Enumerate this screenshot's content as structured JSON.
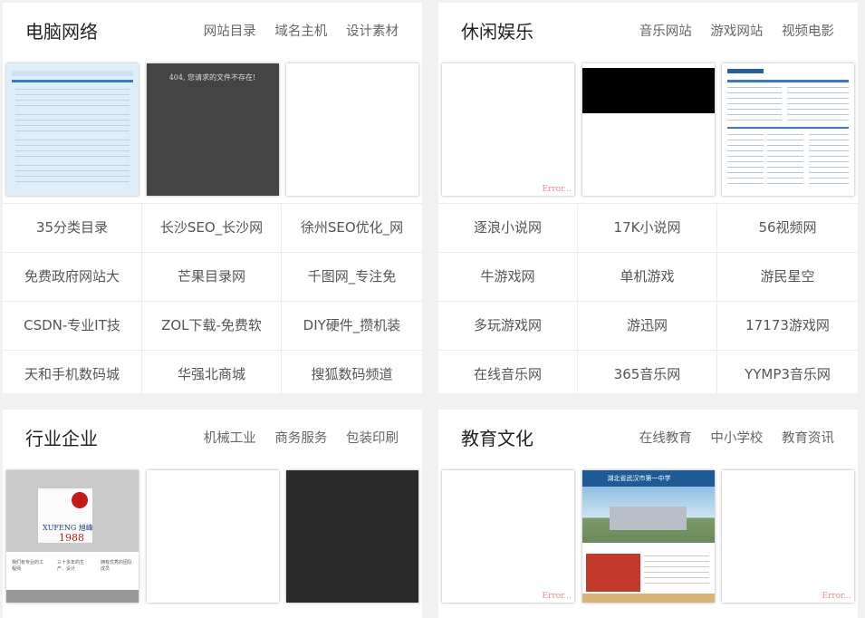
{
  "panels": [
    {
      "title": "电脑网络",
      "links": [
        "网站目录",
        "域名主机",
        "设计素材"
      ],
      "thumb_text": {
        "t1": "404, 您请求的文件不存在!"
      },
      "items": [
        "35分类目录",
        "长沙SEO_长沙网",
        "徐州SEO优化_网",
        "免费政府网站大",
        "芒果目录网",
        "千图网_专注免",
        "CSDN-专业IT技",
        "ZOL下载-免费软",
        "DIY硬件_攒机装",
        "天和手机数码城",
        "华强北商城",
        "搜狐数码频道"
      ]
    },
    {
      "title": "休闲娱乐",
      "links": [
        "音乐网站",
        "游戏网站",
        "视频电影"
      ],
      "thumb_text": {
        "t0": "Error..."
      },
      "items": [
        "逐浪小说网",
        "17K小说网",
        "56视频网",
        "牛游戏网",
        "单机游戏",
        "游民星空",
        "多玩游戏网",
        "游迅网",
        "17173游戏网",
        "在线音乐网",
        "365音乐网",
        "YYMP3音乐网"
      ]
    },
    {
      "title": "行业企业",
      "links": [
        "机械工业",
        "商务服务",
        "包装印刷"
      ],
      "thumb_text": {
        "brand": "XUFENG 旭峰",
        "year": "1988",
        "c1": "我们有专业的工程师",
        "c2": "三十多年的生产、设计",
        "c3": "拥有优秀的团队成员"
      }
    },
    {
      "title": "教育文化",
      "links": [
        "在线教育",
        "中小学校",
        "教育资讯"
      ],
      "thumb_text": {
        "t0": "Error...",
        "t2": "Error...",
        "school": "湖北省武汉市第一中学"
      }
    }
  ]
}
